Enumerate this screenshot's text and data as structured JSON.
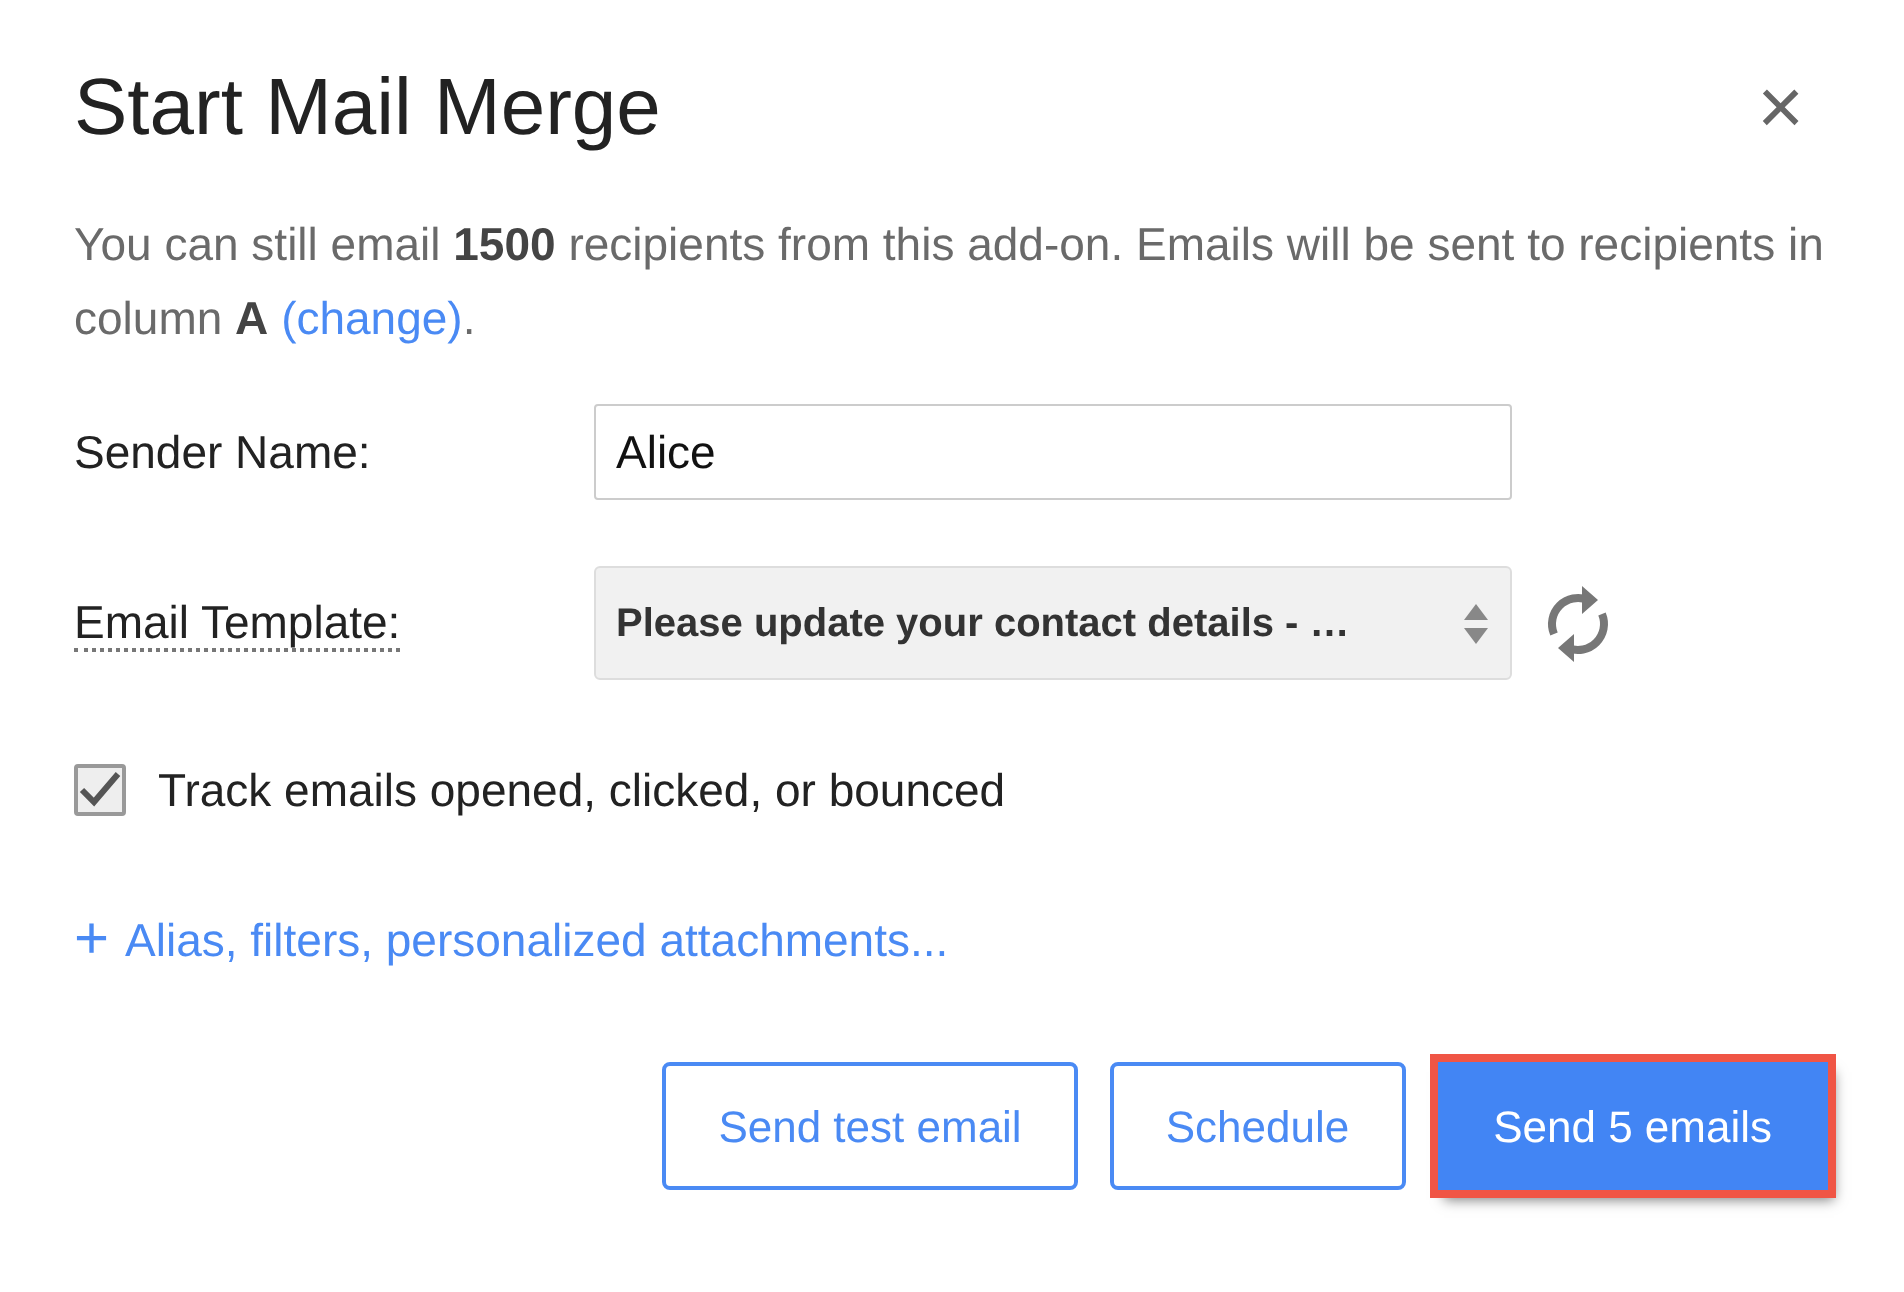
{
  "dialog": {
    "title": "Start Mail Merge",
    "close": "×"
  },
  "intro": {
    "text": "You can still email **1500** recipients from this add-on. Emails will be sent to recipients in column **A** ",
    "link": "(change)",
    "after": "."
  },
  "sender_name": {
    "label": "Sender Name:",
    "value": "Alice"
  },
  "email_template": {
    "label": "Email Template:",
    "value": "Please update your contact details - …"
  },
  "track": {
    "label": "Track emails opened, clicked, or bounced",
    "checked": true
  },
  "options_link": {
    "icon": "+",
    "label": "Alias, filters, personalized attachments..."
  },
  "buttons": [
    {
      "label": "Send test email",
      "kind": "outline",
      "highlighted": false
    },
    {
      "label": "Schedule",
      "kind": "outline",
      "highlighted": false
    },
    {
      "label": "Send 5 emails",
      "kind": "primary",
      "highlighted": true
    }
  ]
}
